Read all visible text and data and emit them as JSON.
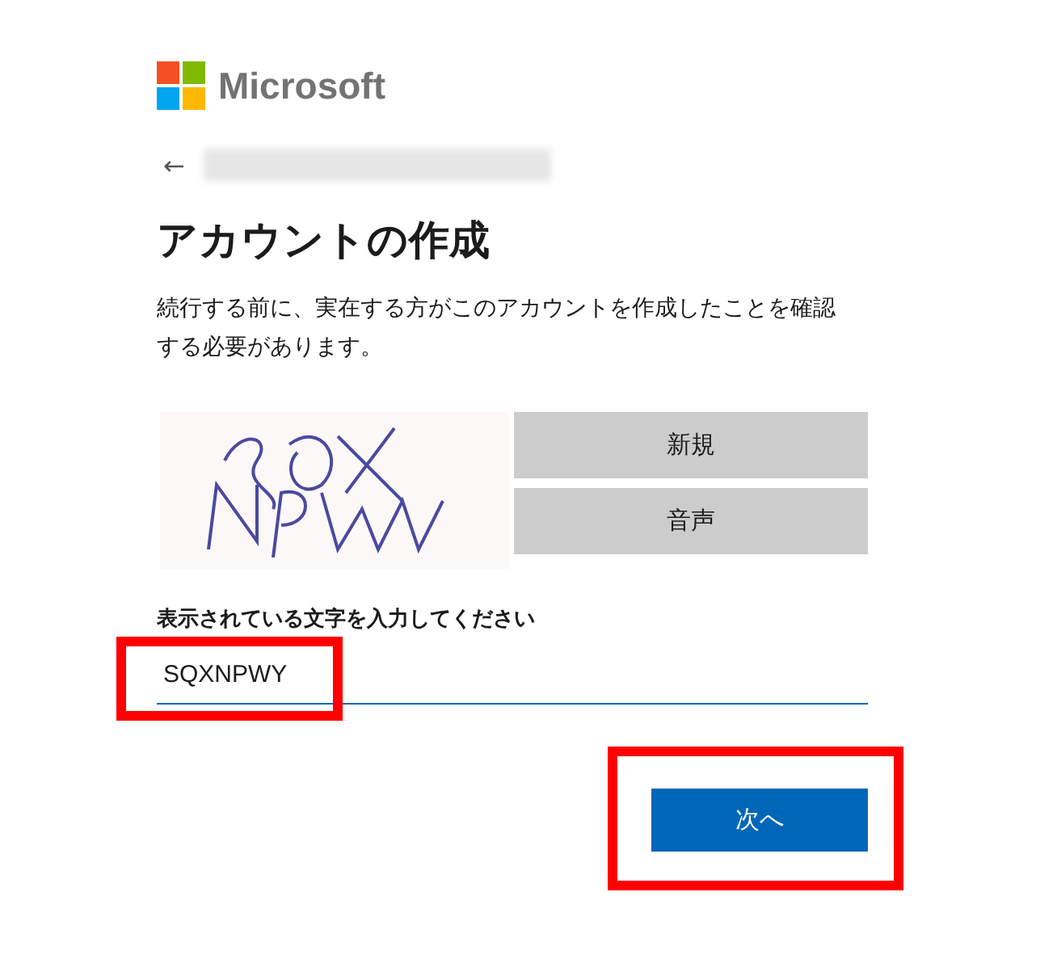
{
  "brand": {
    "name": "Microsoft"
  },
  "back": {
    "icon": "←"
  },
  "title": "アカウントの作成",
  "description": "続行する前に、実在する方がこのアカウントを作成したことを確認する必要があります。",
  "captcha": {
    "kind": "picture",
    "buttons": [
      "新規",
      "音声"
    ]
  },
  "field": {
    "label": "表示されている文字を入力してください",
    "value": "SQXNPWY",
    "highlighted": true
  },
  "next_button": {
    "label": "次へ",
    "highlighted": true
  }
}
